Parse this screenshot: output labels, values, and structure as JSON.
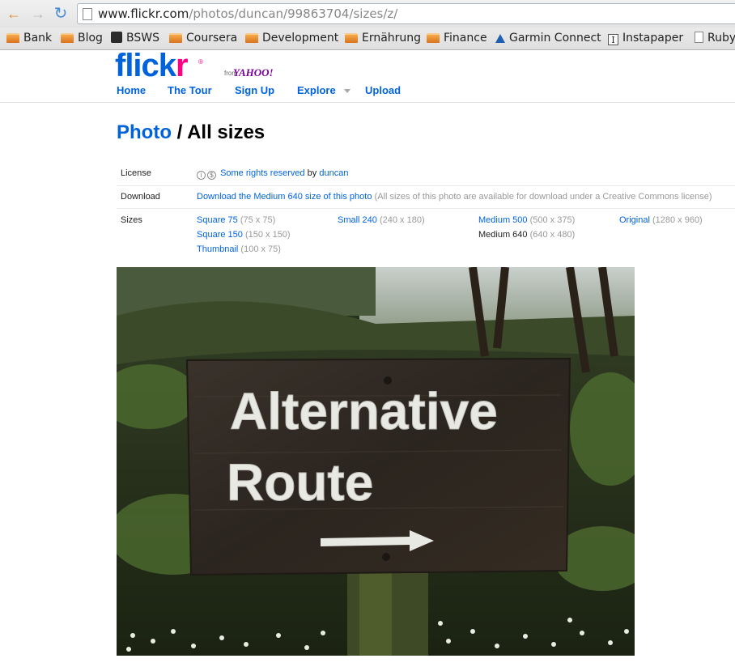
{
  "browser": {
    "url_host": "www.flickr.com",
    "url_path": "/photos/duncan/99863704/sizes/z/",
    "bookmarks": [
      {
        "label": "Bank",
        "icon": "folder-icon"
      },
      {
        "label": "Blog",
        "icon": "folder-icon"
      },
      {
        "label": "BSWS",
        "icon": "bsws-icon"
      },
      {
        "label": "Coursera",
        "icon": "folder-icon"
      },
      {
        "label": "Development",
        "icon": "folder-icon"
      },
      {
        "label": "Ernährung",
        "icon": "folder-icon"
      },
      {
        "label": "Finance",
        "icon": "folder-icon"
      },
      {
        "label": "Garmin Connect",
        "icon": "garmin-icon"
      },
      {
        "label": "Instapaper",
        "icon": "instapaper-icon"
      },
      {
        "label": "Ruby",
        "icon": "page-icon"
      }
    ]
  },
  "header": {
    "logo_flick": "flick",
    "logo_r": "r",
    "logo_from": "from",
    "logo_yahoo": "YAHOO!",
    "nav": [
      "Home",
      "The Tour",
      "Sign Up",
      "Explore",
      "Upload"
    ]
  },
  "page": {
    "title_link": "Photo",
    "title_rest": " / All sizes"
  },
  "meta": {
    "license_label": "License",
    "license_link": "Some rights reserved",
    "license_by": " by ",
    "license_owner": "duncan",
    "download_label": "Download",
    "download_link": "Download the Medium 640 size of this photo",
    "download_note": " (All sizes of this photo are available for download under a Creative Commons license)",
    "sizes_label": "Sizes",
    "sizes": [
      {
        "name": "Square 75",
        "dims": " (75 x 75)",
        "current": false
      },
      {
        "name": "Square 150",
        "dims": " (150 x 150)",
        "current": false
      },
      {
        "name": "Thumbnail",
        "dims": " (100 x 75)",
        "current": false
      },
      {
        "name": "Small 240",
        "dims": " (240 x 180)",
        "current": false
      },
      {
        "name": "Medium 500",
        "dims": " (500 x 375)",
        "current": false
      },
      {
        "name": "Medium 640",
        "dims": " (640 x 480)",
        "current": true
      },
      {
        "name": "Original",
        "dims": " (1280 x 960)",
        "current": false
      }
    ]
  },
  "photo": {
    "sign_line1": "Alternative",
    "sign_line2": "Route"
  },
  "colors": {
    "flickr_blue": "#0063dc",
    "flickr_pink": "#ff0084",
    "yahoo_purple": "#7b0099"
  }
}
